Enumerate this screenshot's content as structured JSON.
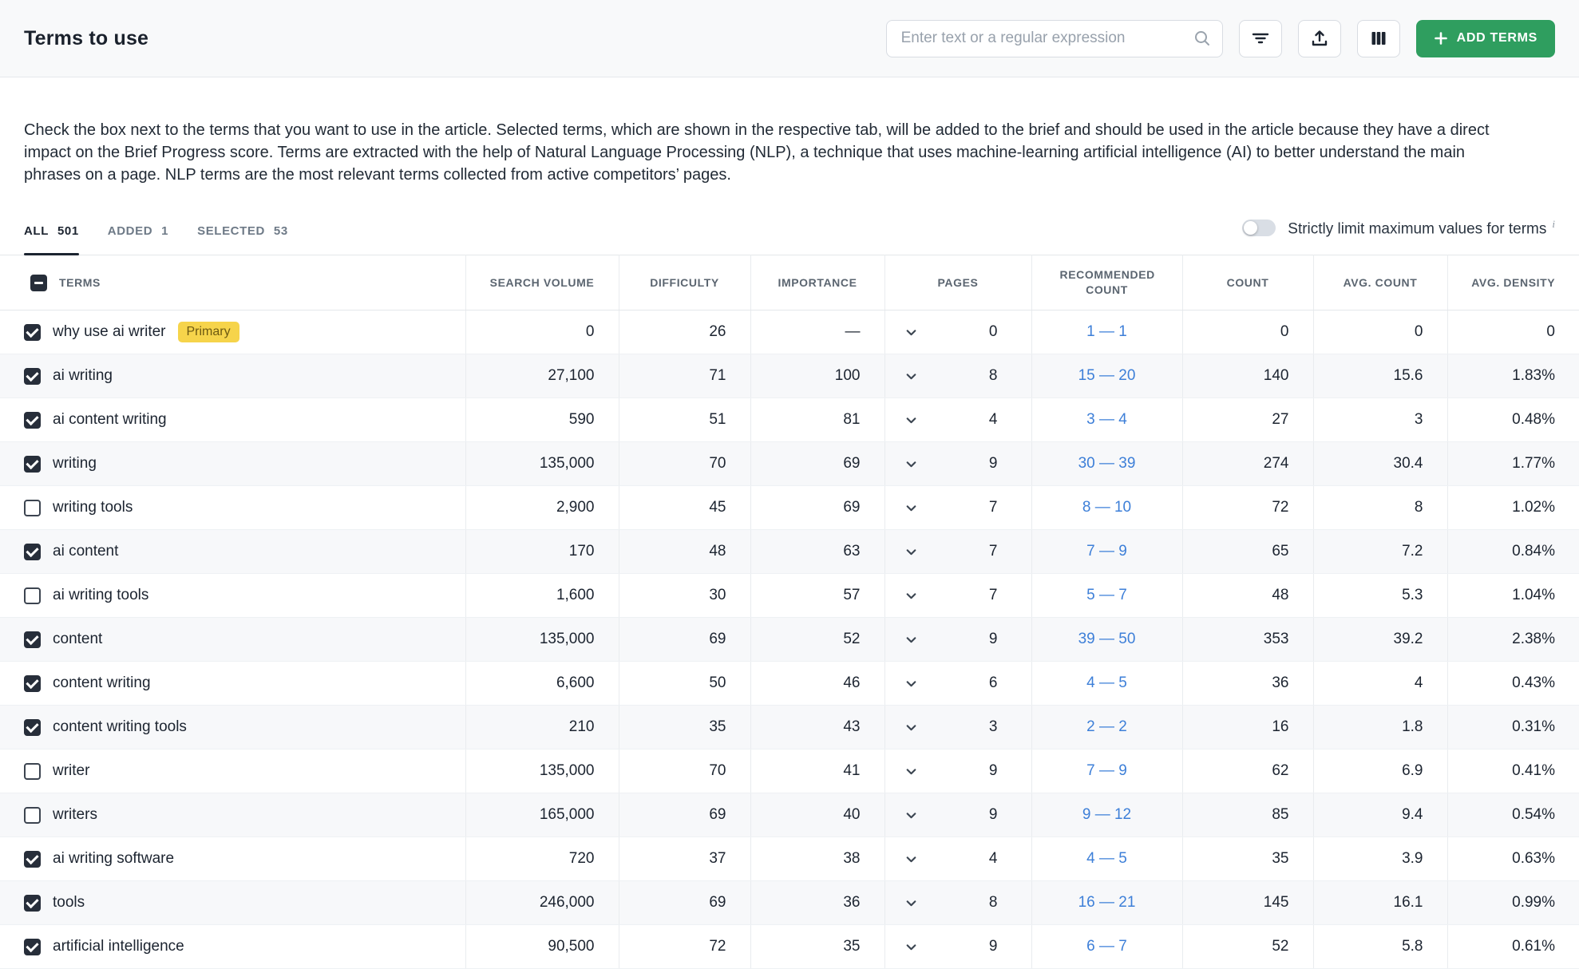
{
  "header": {
    "title": "Terms to use",
    "search_placeholder": "Enter text or a regular expression",
    "add_terms_label": "ADD TERMS"
  },
  "description": "Check the box next to the terms that you want to use in the article. Selected terms, which are shown in the respective tab, will be added to the brief and should be used in the article because they have a direct impact on the Brief Progress score. Terms are extracted with the help of Natural Language Processing (NLP), a technique that uses machine-learning artificial intelligence (AI) to better understand the main phrases on a page. NLP terms are the most relevant terms collected from active competitors’ pages.",
  "tabs": [
    {
      "label": "ALL",
      "count": "501",
      "active": true
    },
    {
      "label": "ADDED",
      "count": "1",
      "active": false
    },
    {
      "label": "SELECTED",
      "count": "53",
      "active": false
    }
  ],
  "toggle": {
    "label": "Strictly limit maximum values for terms",
    "info": "i",
    "on": false
  },
  "table": {
    "columns": [
      "TERMS",
      "SEARCH VOLUME",
      "DIFFICULTY",
      "IMPORTANCE",
      "PAGES",
      "RECOMMENDED COUNT",
      "COUNT",
      "AVG. COUNT",
      "AVG. DENSITY"
    ],
    "rows": [
      {
        "term": "why use ai writer",
        "badge": "Primary",
        "checked": true,
        "search_volume": "0",
        "difficulty": "26",
        "importance": "—",
        "pages": "0",
        "recommended": "1 — 1",
        "count": "0",
        "avg_count": "0",
        "avg_density": "0"
      },
      {
        "term": "ai writing",
        "badge": null,
        "checked": true,
        "search_volume": "27,100",
        "difficulty": "71",
        "importance": "100",
        "pages": "8",
        "recommended": "15 — 20",
        "count": "140",
        "avg_count": "15.6",
        "avg_density": "1.83%"
      },
      {
        "term": "ai content writing",
        "badge": null,
        "checked": true,
        "search_volume": "590",
        "difficulty": "51",
        "importance": "81",
        "pages": "4",
        "recommended": "3 — 4",
        "count": "27",
        "avg_count": "3",
        "avg_density": "0.48%"
      },
      {
        "term": "writing",
        "badge": null,
        "checked": true,
        "search_volume": "135,000",
        "difficulty": "70",
        "importance": "69",
        "pages": "9",
        "recommended": "30 — 39",
        "count": "274",
        "avg_count": "30.4",
        "avg_density": "1.77%"
      },
      {
        "term": "writing tools",
        "badge": null,
        "checked": false,
        "search_volume": "2,900",
        "difficulty": "45",
        "importance": "69",
        "pages": "7",
        "recommended": "8 — 10",
        "count": "72",
        "avg_count": "8",
        "avg_density": "1.02%"
      },
      {
        "term": "ai content",
        "badge": null,
        "checked": true,
        "search_volume": "170",
        "difficulty": "48",
        "importance": "63",
        "pages": "7",
        "recommended": "7 — 9",
        "count": "65",
        "avg_count": "7.2",
        "avg_density": "0.84%"
      },
      {
        "term": "ai writing tools",
        "badge": null,
        "checked": false,
        "search_volume": "1,600",
        "difficulty": "30",
        "importance": "57",
        "pages": "7",
        "recommended": "5 — 7",
        "count": "48",
        "avg_count": "5.3",
        "avg_density": "1.04%"
      },
      {
        "term": "content",
        "badge": null,
        "checked": true,
        "search_volume": "135,000",
        "difficulty": "69",
        "importance": "52",
        "pages": "9",
        "recommended": "39 — 50",
        "count": "353",
        "avg_count": "39.2",
        "avg_density": "2.38%"
      },
      {
        "term": "content writing",
        "badge": null,
        "checked": true,
        "search_volume": "6,600",
        "difficulty": "50",
        "importance": "46",
        "pages": "6",
        "recommended": "4 — 5",
        "count": "36",
        "avg_count": "4",
        "avg_density": "0.43%"
      },
      {
        "term": "content writing tools",
        "badge": null,
        "checked": true,
        "search_volume": "210",
        "difficulty": "35",
        "importance": "43",
        "pages": "3",
        "recommended": "2 — 2",
        "count": "16",
        "avg_count": "1.8",
        "avg_density": "0.31%"
      },
      {
        "term": "writer",
        "badge": null,
        "checked": false,
        "search_volume": "135,000",
        "difficulty": "70",
        "importance": "41",
        "pages": "9",
        "recommended": "7 — 9",
        "count": "62",
        "avg_count": "6.9",
        "avg_density": "0.41%"
      },
      {
        "term": "writers",
        "badge": null,
        "checked": false,
        "search_volume": "165,000",
        "difficulty": "69",
        "importance": "40",
        "pages": "9",
        "recommended": "9 — 12",
        "count": "85",
        "avg_count": "9.4",
        "avg_density": "0.54%"
      },
      {
        "term": "ai writing software",
        "badge": null,
        "checked": true,
        "search_volume": "720",
        "difficulty": "37",
        "importance": "38",
        "pages": "4",
        "recommended": "4 — 5",
        "count": "35",
        "avg_count": "3.9",
        "avg_density": "0.63%"
      },
      {
        "term": "tools",
        "badge": null,
        "checked": true,
        "search_volume": "246,000",
        "difficulty": "69",
        "importance": "36",
        "pages": "8",
        "recommended": "16 — 21",
        "count": "145",
        "avg_count": "16.1",
        "avg_density": "0.99%"
      },
      {
        "term": "artificial intelligence",
        "badge": null,
        "checked": true,
        "search_volume": "90,500",
        "difficulty": "72",
        "importance": "35",
        "pages": "9",
        "recommended": "6 — 7",
        "count": "52",
        "avg_count": "5.8",
        "avg_density": "0.61%"
      }
    ]
  },
  "colors": {
    "accent_green": "#2f9e5f",
    "link_blue": "#3d7fd8",
    "badge_yellow": "#f6d44b",
    "checkbox_dark": "#272e3a"
  }
}
